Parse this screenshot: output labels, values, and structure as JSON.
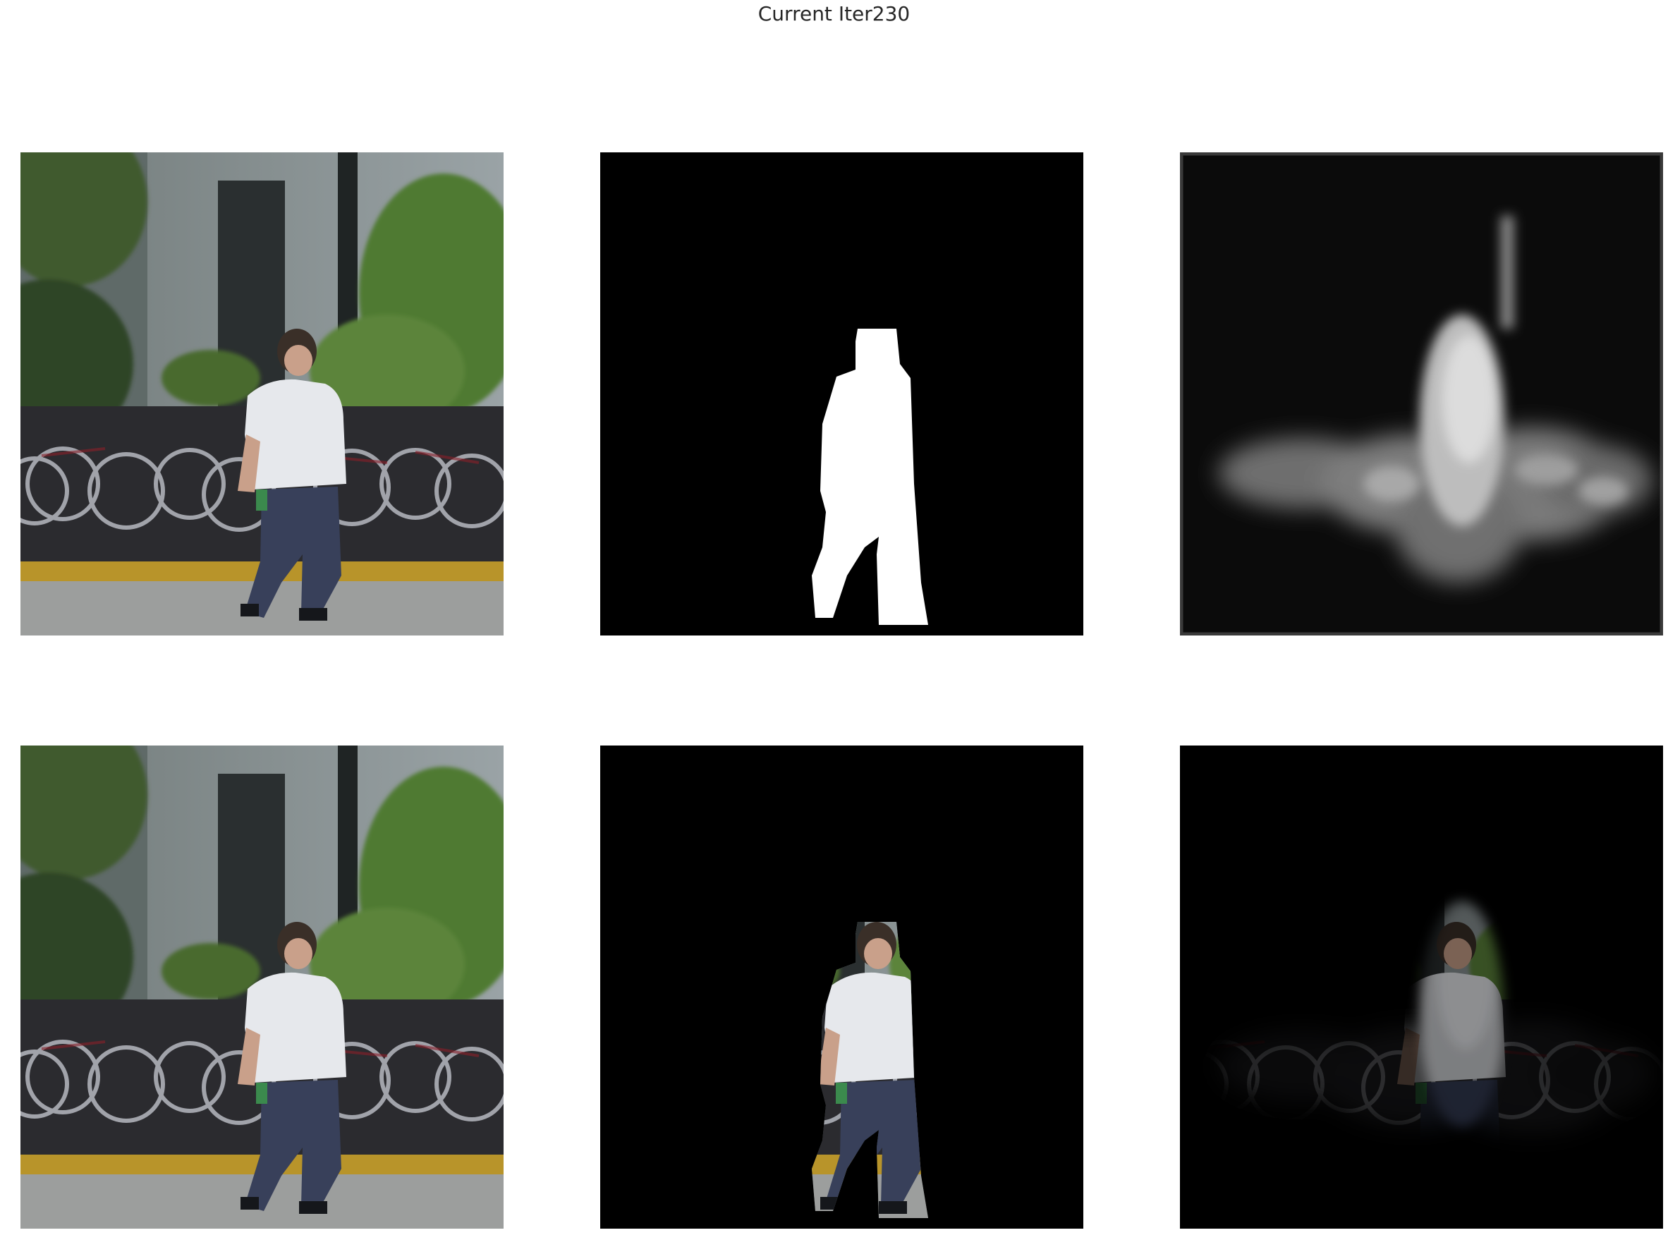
{
  "figure": {
    "title": "Current Iter230"
  },
  "panels": [
    {
      "row": 1,
      "col": 1,
      "content": "input-photo"
    },
    {
      "row": 1,
      "col": 2,
      "content": "ground-truth-mask"
    },
    {
      "row": 1,
      "col": 3,
      "content": "predicted-saliency-map"
    },
    {
      "row": 2,
      "col": 1,
      "content": "input-photo"
    },
    {
      "row": 2,
      "col": 2,
      "content": "masked-photo-ground-truth"
    },
    {
      "row": 2,
      "col": 3,
      "content": "masked-photo-prediction"
    }
  ]
}
